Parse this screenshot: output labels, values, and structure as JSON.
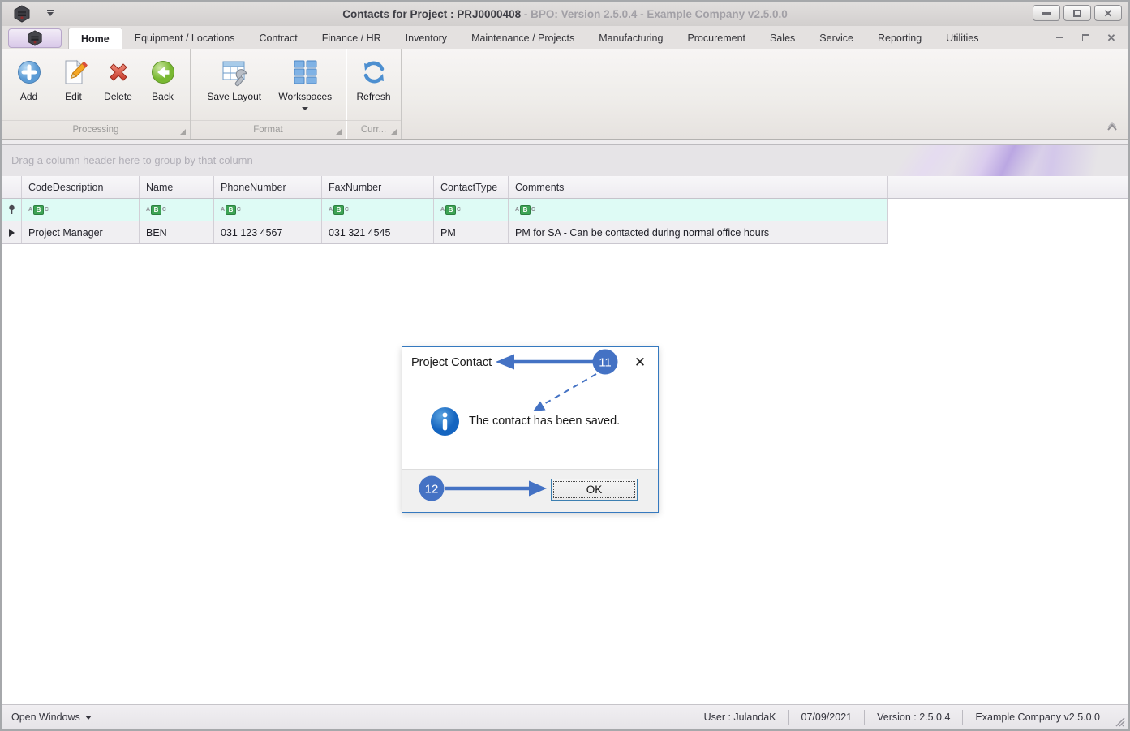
{
  "window": {
    "title": "Contacts for Project : PRJ0000408",
    "title_suffix": " - BPO: Version 2.5.0.4 - Example Company v2.5.0.0"
  },
  "tabs": [
    "Home",
    "Equipment / Locations",
    "Contract",
    "Finance / HR",
    "Inventory",
    "Maintenance / Projects",
    "Manufacturing",
    "Procurement",
    "Sales",
    "Service",
    "Reporting",
    "Utilities"
  ],
  "ribbon": {
    "buttons": {
      "add": "Add",
      "edit": "Edit",
      "delete": "Delete",
      "back": "Back",
      "save_layout": "Save Layout",
      "workspaces": "Workspaces",
      "refresh": "Refresh"
    },
    "groups": {
      "processing": "Processing",
      "format": "Format",
      "current": "Curr..."
    }
  },
  "grid": {
    "group_panel_text": "Drag a column header here to group by that column",
    "columns": [
      "CodeDescription",
      "Name",
      "PhoneNumber",
      "FaxNumber",
      "ContactType",
      "Comments"
    ],
    "filter_letters": [
      "A",
      "B",
      "C"
    ],
    "rows": [
      [
        "Project Manager",
        "BEN",
        "031 123 4567",
        "031 321 4545",
        "PM",
        "PM for SA - Can be contacted during normal office hours"
      ]
    ]
  },
  "dialog": {
    "title": "Project Contact",
    "message": "The contact has been saved.",
    "ok_label": "OK",
    "close_glyph": "✕"
  },
  "annotations": {
    "step_11": "11",
    "step_12": "12"
  },
  "statusbar": {
    "open_windows": "Open Windows",
    "user": "User : JulandaK",
    "date": "07/09/2021",
    "version": "Version : 2.5.0.4",
    "company": "Example Company v2.5.0.0"
  },
  "colors": {
    "annotation_blue": "#4472c4",
    "dialog_border": "#3579bf",
    "filter_row_bg": "#defbf5",
    "filter_badge_green": "#3da455",
    "info_icon_blue": "#2277cc",
    "titlebar_bg": "#d8d5d4",
    "ribbon_bg": "#efedea"
  }
}
